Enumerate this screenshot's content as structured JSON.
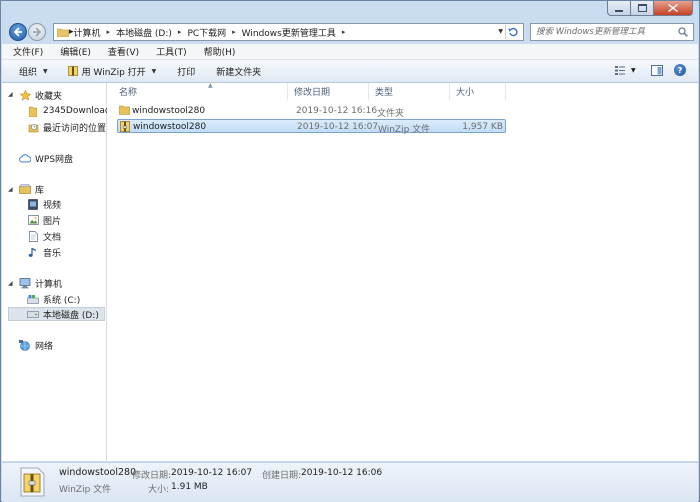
{
  "address_bar": {
    "crumbs": [
      "计算机",
      "本地磁盘 (D:)",
      "PC下载网",
      "Windows更新管理工具"
    ]
  },
  "search": {
    "placeholder": "搜索 Windows更新管理工具"
  },
  "menu": [
    "文件(F)",
    "编辑(E)",
    "查看(V)",
    "工具(T)",
    "帮助(H)"
  ],
  "command_bar": {
    "organize": "组织",
    "open_with": "用 WinZip 打开",
    "print": "打印",
    "new_folder": "新建文件夹"
  },
  "nav": {
    "favorites": "收藏夹",
    "favorites_items": [
      "2345Downloads",
      "最近访问的位置"
    ],
    "wps": "WPS网盘",
    "libraries": "库",
    "library_items": [
      "视频",
      "图片",
      "文档",
      "音乐"
    ],
    "computer": "计算机",
    "computer_items": [
      "系统 (C:)",
      "本地磁盘 (D:)"
    ],
    "network": "网络"
  },
  "columns": [
    "名称",
    "修改日期",
    "类型",
    "大小"
  ],
  "files": [
    {
      "name": "windowstool280",
      "date": "2019-10-12 16:16",
      "type": "文件夹",
      "size": "",
      "icon": "folder-icon"
    },
    {
      "name": "windowstool280",
      "date": "2019-10-12 16:07",
      "type": "WinZip 文件",
      "size": "1,957 KB",
      "icon": "winzip-file-icon"
    }
  ],
  "details": {
    "name": "windowstool280",
    "type": "WinZip 文件",
    "modified_label": "修改日期:",
    "modified": "2019-10-12 16:07",
    "created_label": "创建日期:",
    "created": "2019-10-12 16:06",
    "size_label": "大小:",
    "size": "1.91 MB"
  },
  "colors": {
    "accent": "#3a72b8",
    "selection": "#c8e0fa",
    "window_frame": "#c9dcf0"
  }
}
